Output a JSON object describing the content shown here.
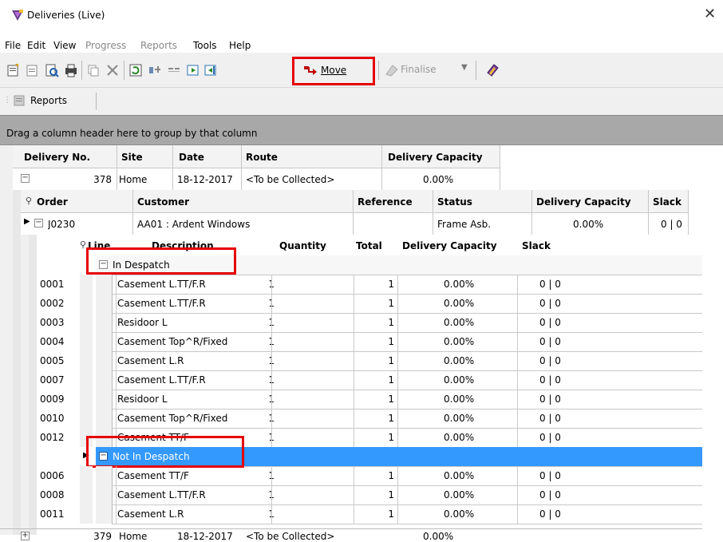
{
  "window": {
    "title": "Deliveries (Live)",
    "close_glyph": "✕"
  },
  "menu": [
    "File",
    "Edit",
    "View",
    "Progress",
    "Reports",
    "Tools",
    "Help"
  ],
  "toolbar": {
    "move_label": "Move",
    "finalise_label": "Finalise"
  },
  "toolbar2": {
    "reports_label": "Reports"
  },
  "group_panel": {
    "text": "Drag a column header here to group by that column"
  },
  "delivery_columns": [
    "Delivery No.",
    "Site",
    "Date",
    "Route",
    "Delivery Capacity"
  ],
  "delivery": {
    "no": "378",
    "site": "Home",
    "date": "18-12-2017",
    "route": "<To be Collected>",
    "capacity": "0.00%"
  },
  "order_columns": [
    "Order",
    "Customer",
    "Reference",
    "Status",
    "Delivery Capacity",
    "Slack"
  ],
  "order": {
    "order": "J0230",
    "customer": "AA01  : Ardent Windows",
    "reference": "",
    "status": "Frame Asb.",
    "capacity": "0.00%",
    "slack": "0 | 0"
  },
  "line_columns": [
    "Line",
    "Description",
    "Quantity",
    "Total",
    "Delivery Capacity",
    "Slack"
  ],
  "groups": [
    {
      "label": "In Despatch",
      "lines": [
        {
          "line": "0001",
          "desc": "Casement L.TT/F.R",
          "qty": "1",
          "total": "1",
          "cap": "0.00%",
          "slack": "0 | 0"
        },
        {
          "line": "0002",
          "desc": "Casement L.TT/F.R",
          "qty": "1",
          "total": "1",
          "cap": "0.00%",
          "slack": "0 | 0"
        },
        {
          "line": "0003",
          "desc": "Residoor L",
          "qty": "1",
          "total": "1",
          "cap": "0.00%",
          "slack": "0 | 0"
        },
        {
          "line": "0004",
          "desc": "Casement Top^R/Fixed",
          "qty": "1",
          "total": "1",
          "cap": "0.00%",
          "slack": "0 | 0"
        },
        {
          "line": "0005",
          "desc": "Casement L.R",
          "qty": "1",
          "total": "1",
          "cap": "0.00%",
          "slack": "0 | 0"
        },
        {
          "line": "0007",
          "desc": "Casement L.TT/F.R",
          "qty": "1",
          "total": "1",
          "cap": "0.00%",
          "slack": "0 | 0"
        },
        {
          "line": "0009",
          "desc": "Residoor L",
          "qty": "1",
          "total": "1",
          "cap": "0.00%",
          "slack": "0 | 0"
        },
        {
          "line": "0010",
          "desc": "Casement Top^R/Fixed",
          "qty": "1",
          "total": "1",
          "cap": "0.00%",
          "slack": "0 | 0"
        },
        {
          "line": "0012",
          "desc": "Casement TT/F",
          "qty": "1",
          "total": "1",
          "cap": "0.00%",
          "slack": "0 | 0"
        }
      ]
    },
    {
      "label": "Not In Despatch",
      "lines": [
        {
          "line": "0006",
          "desc": "Casement TT/F",
          "qty": "1",
          "total": "1",
          "cap": "0.00%",
          "slack": "0 | 0"
        },
        {
          "line": "0008",
          "desc": "Casement L.TT/F.R",
          "qty": "1",
          "total": "1",
          "cap": "0.00%",
          "slack": "0 | 0"
        },
        {
          "line": "0011",
          "desc": "Casement L.R",
          "qty": "1",
          "total": "1",
          "cap": "0.00%",
          "slack": "0 | 0"
        }
      ]
    }
  ],
  "next_delivery": {
    "no": "379",
    "site": "Home",
    "date": "18-12-2017",
    "route": "<To be Collected>",
    "capacity": "0.00%"
  },
  "colors": {
    "selection": "#3399ff",
    "highlight": "#e60000",
    "group_panel": "#a8a8a8"
  }
}
